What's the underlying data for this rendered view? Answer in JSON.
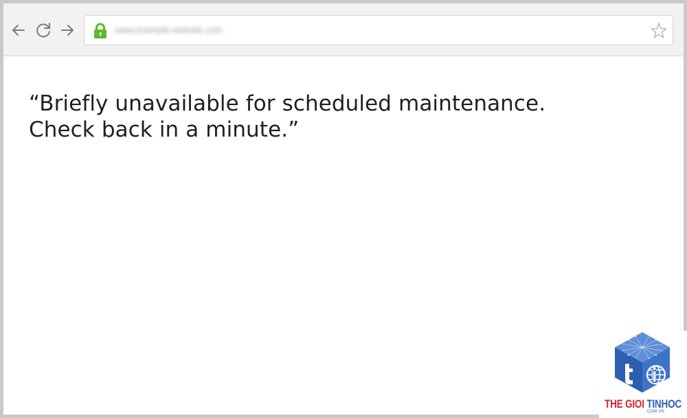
{
  "browser": {
    "url_text": "www.example-website.com",
    "accent_lock_color": "#5cb82f",
    "icons": {
      "back": "arrow-left-icon",
      "reload": "reload-icon",
      "forward": "arrow-right-icon",
      "lock": "lock-icon",
      "bookmark": "star-icon"
    }
  },
  "page": {
    "message_line1": "“Briefly unavailable for scheduled maintenance.",
    "message_line2": "Check back in a minute.”"
  },
  "watermark": {
    "brand_part1": "THE GIOI ",
    "brand_part2": "TINHOC",
    "domain": ".COM.VN",
    "colors": {
      "red": "#d2272e",
      "blue": "#2f5fb3"
    }
  }
}
